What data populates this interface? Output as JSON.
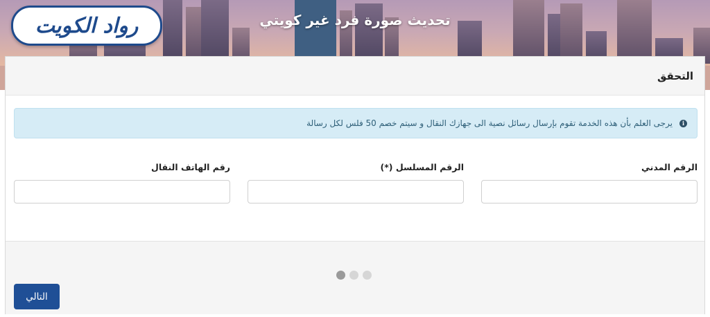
{
  "header": {
    "title": "تحديث صورة فرد غير كويتي",
    "logo_text": "رواد الكويت"
  },
  "card": {
    "title": "التحقق"
  },
  "alert": {
    "icon": "info-icon",
    "text": "يرجى العلم بأن هذه الخدمة تقوم بإرسال رسائل نصية الى جهازك النقال و سيتم خصم 50 فلس لكل رسالة"
  },
  "form": {
    "civil_id_label": "الرقم المدني",
    "civil_id_value": "",
    "serial_label": "الرقم المسلسل (*)",
    "serial_value": "",
    "phone_label": "رقم الهاتف النقال",
    "phone_value": ""
  },
  "steps": {
    "total": 3,
    "current": 1
  },
  "footer": {
    "next_label": "التالي"
  },
  "colors": {
    "primary": "#1f4f96",
    "alert_bg": "#d6ecf6",
    "alert_text": "#2e5f78"
  }
}
